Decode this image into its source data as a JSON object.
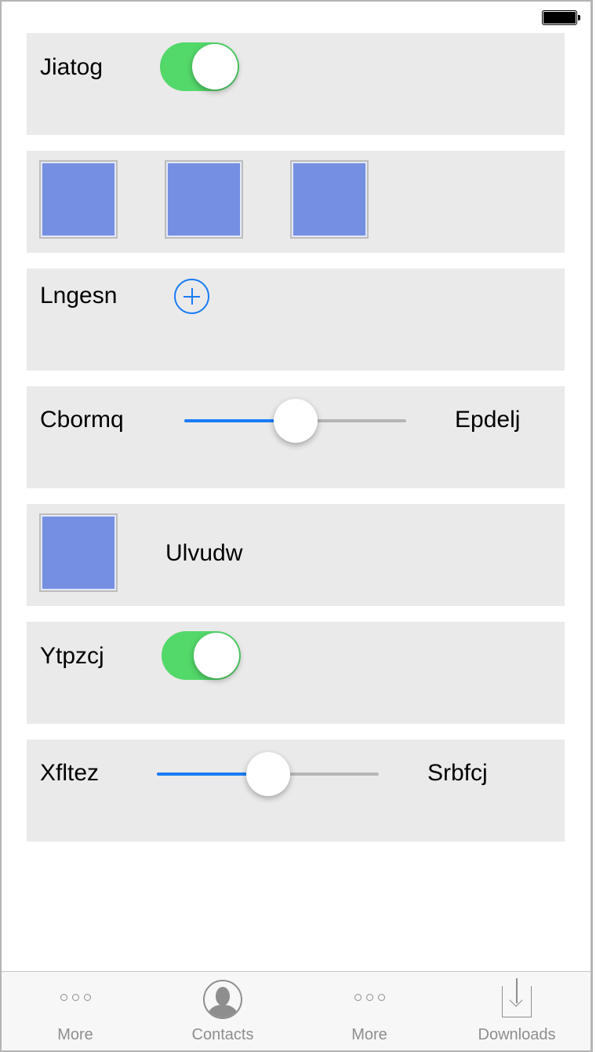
{
  "rows": [
    {
      "type": "toggle",
      "label": "Jiatog",
      "on": true
    },
    {
      "type": "images",
      "count": 3
    },
    {
      "type": "add",
      "label": "Lngesn"
    },
    {
      "type": "slider",
      "label": "Cbormq",
      "right_label": "Epdelj",
      "value": 0.5
    },
    {
      "type": "image-label",
      "label": "Ulvudw"
    },
    {
      "type": "toggle",
      "label": "Ytpzcj",
      "on": true
    },
    {
      "type": "slider",
      "label": "Xfltez",
      "right_label": "Srbfcj",
      "value": 0.5
    }
  ],
  "tabs": [
    {
      "label": "More",
      "icon": "more-icon"
    },
    {
      "label": "Contacts",
      "icon": "contact-icon"
    },
    {
      "label": "More",
      "icon": "more-icon"
    },
    {
      "label": "Downloads",
      "icon": "download-icon"
    }
  ],
  "colors": {
    "accent": "#1a7cf5",
    "toggle_on": "#53d86a",
    "image": "#758fe2",
    "row_bg": "#eaeaea"
  }
}
